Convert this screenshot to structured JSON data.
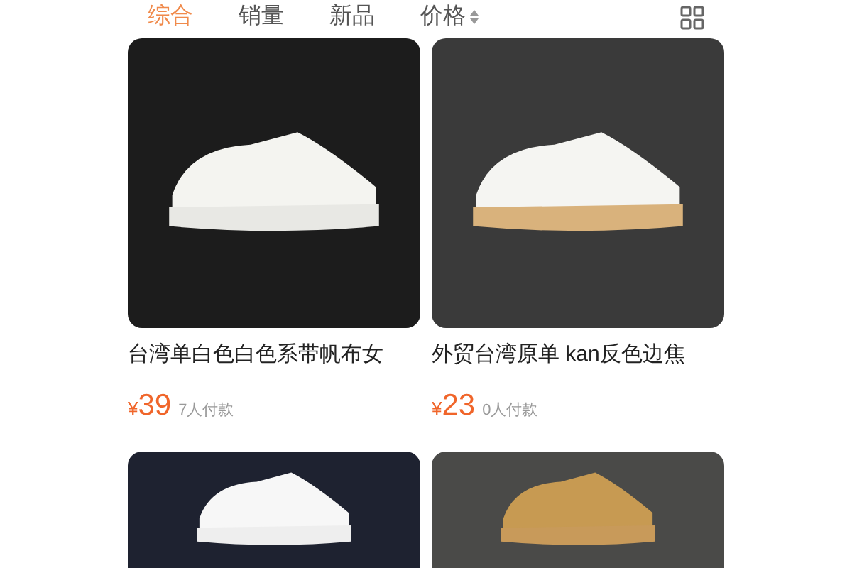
{
  "sort_tabs": [
    {
      "label": "综合",
      "selected": true,
      "kind": "plain"
    },
    {
      "label": "销量",
      "selected": false,
      "kind": "plain"
    },
    {
      "label": "新品",
      "selected": false,
      "kind": "plain"
    },
    {
      "label": "价格",
      "selected": false,
      "kind": "sortable"
    }
  ],
  "products": [
    {
      "title": "台湾单白色白色系带帆布女",
      "currency": "¥",
      "price": "39",
      "sales": "7人付款"
    },
    {
      "title": "外贸台湾原单 kan反色边焦",
      "currency": "¥",
      "price": "23",
      "sales": "0人付款"
    }
  ]
}
